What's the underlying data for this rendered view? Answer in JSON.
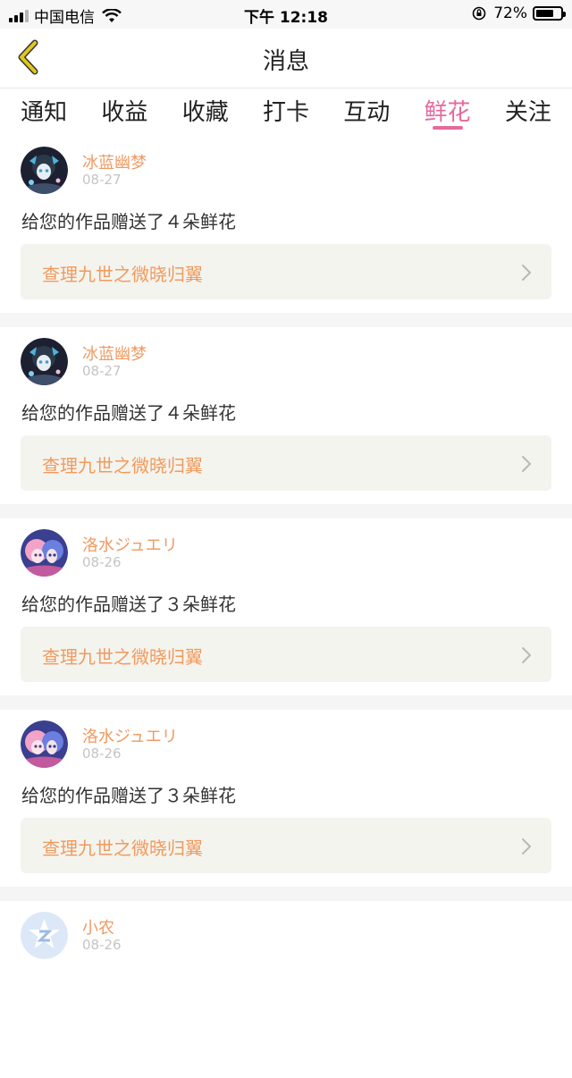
{
  "status_bar": {
    "carrier": "中国电信",
    "time": "下午 12:18",
    "battery": "72%",
    "battery_level": 0.72,
    "icons": [
      "signal-icon",
      "wifi-icon",
      "orientation-lock-icon",
      "battery-icon"
    ]
  },
  "nav": {
    "title": "消息",
    "back_icon": "chevron-left-icon",
    "accent": "#e0c61e"
  },
  "tabs": [
    {
      "label": "通知"
    },
    {
      "label": "收益"
    },
    {
      "label": "收藏"
    },
    {
      "label": "打卡"
    },
    {
      "label": "互动"
    },
    {
      "label": "鲜花",
      "active": true
    },
    {
      "label": "关注"
    }
  ],
  "colors": {
    "active_tab": "#e56a9c",
    "username": "#ef9a62",
    "link_text": "#f19a5e",
    "link_bg": "#f4f4ee"
  },
  "messages": [
    {
      "user": "冰蓝幽梦",
      "date": "08-27",
      "text": "给您的作品赠送了４朵鲜花",
      "link": "查理九世之微晓归翼",
      "avatar_icon": "anime-avatar-dark"
    },
    {
      "user": "冰蓝幽梦",
      "date": "08-27",
      "text": "给您的作品赠送了４朵鲜花",
      "link": "查理九世之微晓归翼",
      "avatar_icon": "anime-avatar-dark"
    },
    {
      "user": "洛水ジュエリ",
      "date": "08-26",
      "text": "给您的作品赠送了３朵鲜花",
      "link": "查理九世之微晓归翼",
      "avatar_icon": "anime-avatar-pink"
    },
    {
      "user": "洛水ジュエリ",
      "date": "08-26",
      "text": "给您的作品赠送了３朵鲜花",
      "link": "查理九世之微晓归翼",
      "avatar_icon": "anime-avatar-pink"
    },
    {
      "user": "小农",
      "date": "08-26",
      "text": "",
      "link": "",
      "avatar_icon": "default-z-avatar"
    }
  ]
}
